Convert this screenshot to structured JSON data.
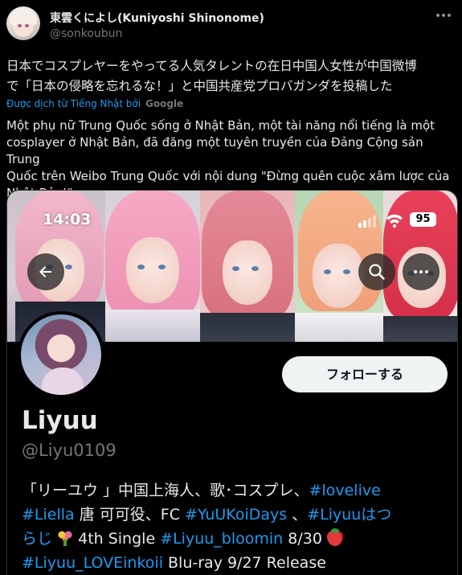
{
  "tweet": {
    "author_name": "東雲くによし(Kuniyoshi Shinonome)",
    "author_handle": "@sonkoubun",
    "text_line1": "日本でコスプレヤーをやってる人気タレントの在日中国人女性が中国微博",
    "text_line2": "で「日本の侵略を忘れるな！」と中国共産党プロバガンダを投稿した",
    "translated_by": "Được dịch từ Tiếng Nhật bởi",
    "translator": "Google",
    "translation_line1": "Một phụ nữ Trung Quốc sống ở Nhật Bản, một tài năng nổi tiếng là một",
    "translation_line2": "cosplayer ở Nhật Bản, đã đăng một tuyên truyền của Đảng Cộng sản Trung",
    "translation_line3": "Quốc trên Weibo Trung Quốc với nội dung \"Đừng quên cuộc xâm lược của",
    "translation_line4": "Nhật Bản!\""
  },
  "screenshot": {
    "status_time": "14:03",
    "battery": "95",
    "follow_label": "フォローする",
    "profile_name": "Liyuu",
    "profile_handle": "@Liyu0109",
    "bio": {
      "r1_a": "「リーユウ 」中国上海人、歌･コスプレ、",
      "r1_tag": "#lovelive",
      "r2_tag1": "#Liella",
      "r2_a": " 唐 可可役、FC ",
      "r2_tag2": "#YuUKoiDays",
      "r2_b": " 、",
      "r2_tag3": "#Liyuuはつ",
      "r3_tag1": "らじ",
      "r3_a": " 4th Single ",
      "r3_tag2": "#Liyuu_bloomin",
      "r3_b": " 8/30 ",
      "r4_tag1": "#Liyuu_LOVEinkoii",
      "r4_a": " Blu-ray 9/27 Release"
    }
  },
  "icons": {
    "more": "more-icon",
    "back": "arrow-left-icon",
    "search": "search-icon",
    "overflow": "more-horizontal-icon",
    "signal": "signal-icon",
    "wifi": "wifi-icon",
    "battery": "battery-icon",
    "bouquet": "bouquet-icon",
    "strawberry": "strawberry-icon"
  },
  "colors": {
    "background": "#000000",
    "text": "#e7e9ea",
    "secondary": "#71767b",
    "link": "#1d9bf0",
    "follow_bg": "#eff3f4"
  }
}
